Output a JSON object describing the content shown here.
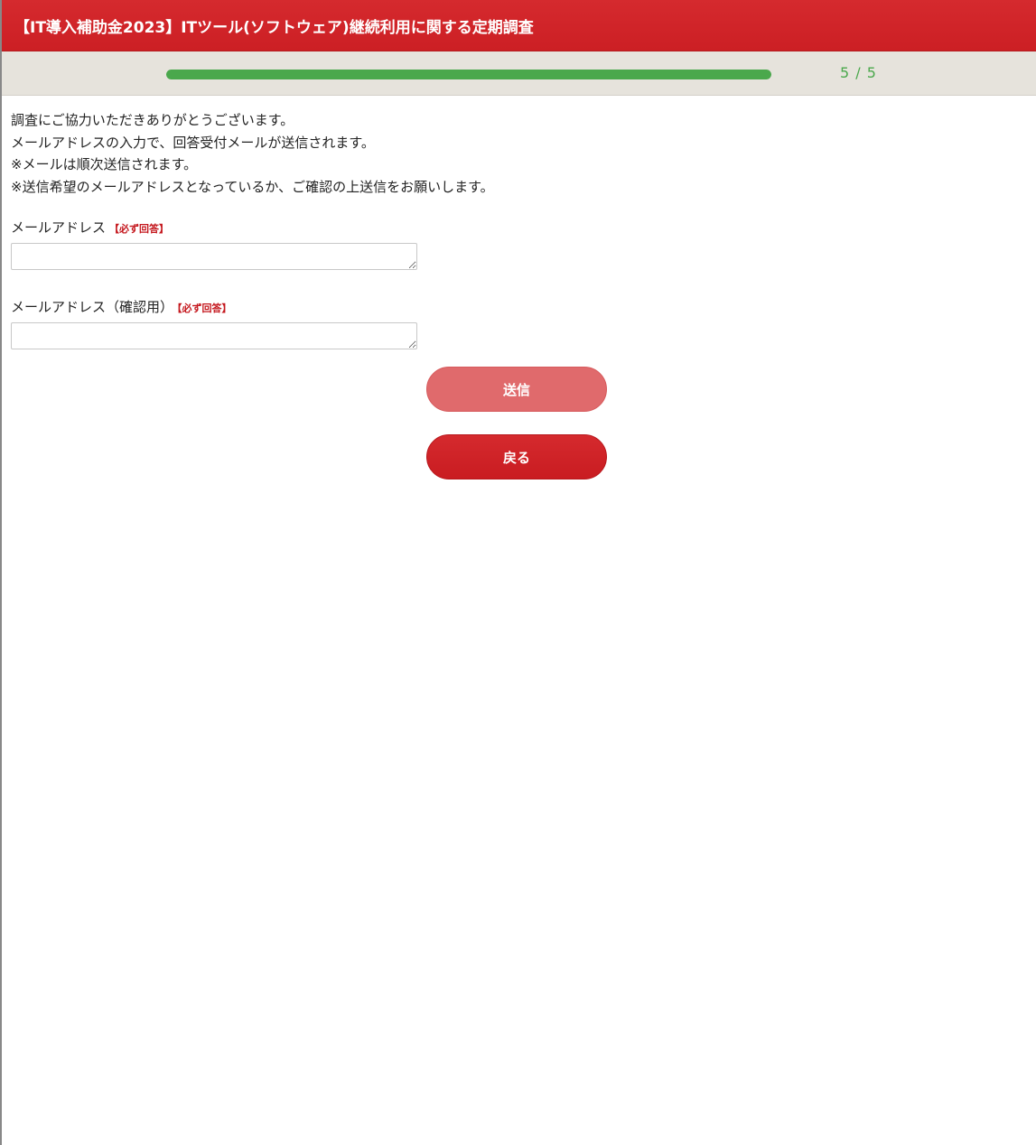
{
  "header": {
    "title": "【IT導入補助金2023】ITツール(ソフトウェア)継続利用に関する定期調査"
  },
  "progress": {
    "current": 5,
    "total": 5,
    "fraction": 1.0,
    "label": "5 / 5",
    "fill_color": "#4aa84c"
  },
  "intro": {
    "lines": [
      "調査にご協力いただきありがとうございます。",
      "メールアドレスの入力で、回答受付メールが送信されます。",
      "※メールは順次送信されます。",
      "※送信希望のメールアドレスとなっているか、ご確認の上送信をお願いします。"
    ]
  },
  "fields": {
    "email": {
      "label": "メールアドレス",
      "required_badge": "【必ず回答】",
      "value": ""
    },
    "email_confirm": {
      "label": "メールアドレス（確認用）",
      "required_badge": "【必ず回答】",
      "value": ""
    }
  },
  "buttons": {
    "submit_label": "送信",
    "back_label": "戻る"
  },
  "colors": {
    "brand_red": "#cc1f24",
    "submit_button": "#e06a6c",
    "progress_green": "#4aa84c",
    "required_text": "#c4161c"
  }
}
